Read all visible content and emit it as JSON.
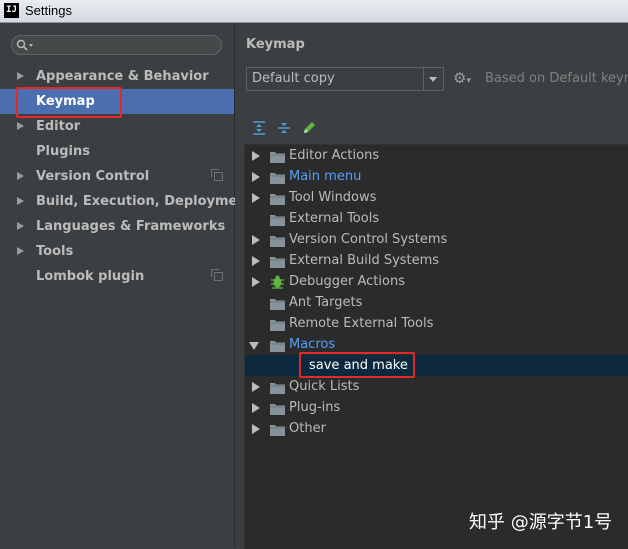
{
  "window": {
    "title": "Settings",
    "logo": "IJ"
  },
  "sidebar": {
    "search": {
      "value": "",
      "icon": "search-icon"
    },
    "items": [
      {
        "label": "Appearance & Behavior",
        "expandable": true,
        "selected": false,
        "copy_icon": false
      },
      {
        "label": "Keymap",
        "expandable": false,
        "selected": true,
        "copy_icon": false
      },
      {
        "label": "Editor",
        "expandable": true,
        "selected": false,
        "copy_icon": false
      },
      {
        "label": "Plugins",
        "expandable": false,
        "selected": false,
        "copy_icon": false
      },
      {
        "label": "Version Control",
        "expandable": true,
        "selected": false,
        "copy_icon": true
      },
      {
        "label": "Build, Execution, Deployment",
        "expandable": true,
        "selected": false,
        "copy_icon": false
      },
      {
        "label": "Languages & Frameworks",
        "expandable": true,
        "selected": false,
        "copy_icon": false
      },
      {
        "label": "Tools",
        "expandable": true,
        "selected": false,
        "copy_icon": false
      },
      {
        "label": "Lombok plugin",
        "expandable": false,
        "selected": false,
        "copy_icon": true
      }
    ]
  },
  "main": {
    "title": "Keymap",
    "keymap_select": {
      "value": "Default copy"
    },
    "gear_icon": "gear-icon",
    "based_on": "Based on Default keyma",
    "toolbar": [
      "expand-all-icon",
      "collapse-all-icon",
      "edit-icon"
    ],
    "tree": [
      {
        "label": "Editor Actions",
        "state": "collapsed",
        "link": false,
        "icon": "folder-icon"
      },
      {
        "label": "Main menu",
        "state": "collapsed",
        "link": true,
        "icon": "folder-icon"
      },
      {
        "label": "Tool Windows",
        "state": "collapsed",
        "link": false,
        "icon": "folder-icon"
      },
      {
        "label": "External Tools",
        "state": "none",
        "link": false,
        "icon": "folder-icon"
      },
      {
        "label": "Version Control Systems",
        "state": "collapsed",
        "link": false,
        "icon": "folder-icon"
      },
      {
        "label": "External Build Systems",
        "state": "collapsed",
        "link": false,
        "icon": "folder-icon"
      },
      {
        "label": "Debugger Actions",
        "state": "collapsed",
        "link": false,
        "icon": "bug-icon"
      },
      {
        "label": "Ant Targets",
        "state": "none",
        "link": false,
        "icon": "folder-icon"
      },
      {
        "label": "Remote External Tools",
        "state": "none",
        "link": false,
        "icon": "folder-icon"
      },
      {
        "label": "Macros",
        "state": "expanded",
        "link": true,
        "icon": "folder-icon"
      },
      {
        "label": "save and make",
        "state": "leaf",
        "link": false,
        "selected": true
      },
      {
        "label": "Quick Lists",
        "state": "collapsed",
        "link": false,
        "icon": "folder-icon"
      },
      {
        "label": "Plug-ins",
        "state": "collapsed",
        "link": false,
        "icon": "folder-icon"
      },
      {
        "label": "Other",
        "state": "collapsed",
        "link": false,
        "icon": "folder-icon"
      }
    ]
  },
  "watermark": "知乎 @源字节1号",
  "colors": {
    "selection": "#4b6eaf",
    "link": "#589df6",
    "highlight_box": "#e52828",
    "tree_selection": "#0d293e"
  }
}
